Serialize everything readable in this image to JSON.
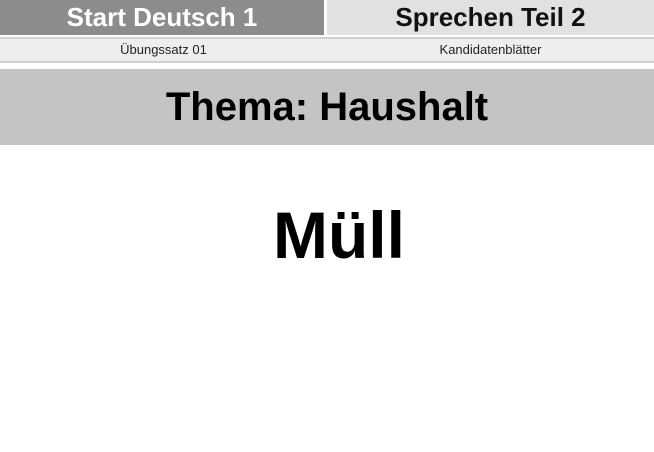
{
  "header": {
    "left_title": "Start Deutsch 1",
    "right_title": "Sprechen Teil 2"
  },
  "subheader": {
    "left_label": "Übungssatz 01",
    "right_label": "Kandidatenblätter"
  },
  "theme": {
    "title": "Thema: Haushalt"
  },
  "card": {
    "word": "Müll"
  },
  "colors": {
    "header_left_bg": "#8c8c8c",
    "header_right_bg": "#e1e1e1",
    "theme_bar_bg": "#c4c4c4"
  }
}
